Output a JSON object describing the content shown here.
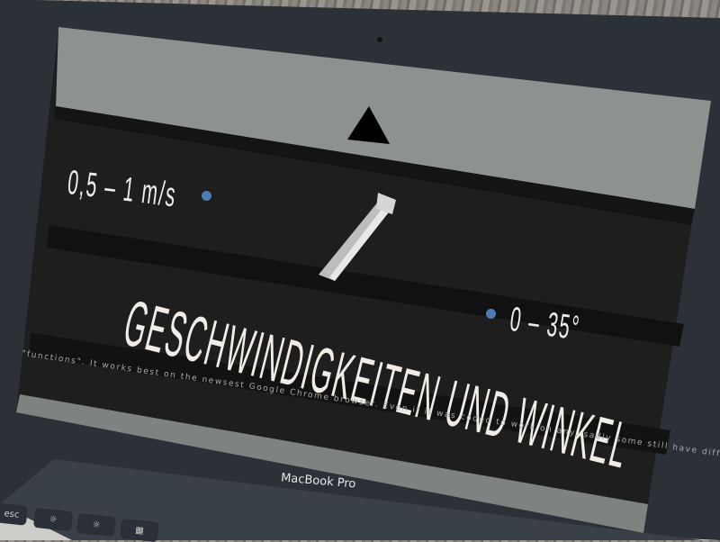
{
  "screen": {
    "nav_icon": "triangle-up-icon",
    "speed_label": "0,5 – 1 m/s",
    "angle_label": "0 – 35°",
    "title": "GESCHWINDIGKEITEN UND WINKEL",
    "illustration": "escalator-icon",
    "footer_text": "\"functions\". It works best on the newsest Google Chrome browser. Even if it was coded to work on any, sadly some still have difficulties (especially with this",
    "accent_color": "#4f7cb0"
  },
  "laptop": {
    "brand_label": "MacBook Pro",
    "keys": [
      {
        "label": "esc"
      },
      {
        "label": "☼"
      },
      {
        "label": "☼"
      },
      {
        "label": "▦"
      }
    ]
  }
}
